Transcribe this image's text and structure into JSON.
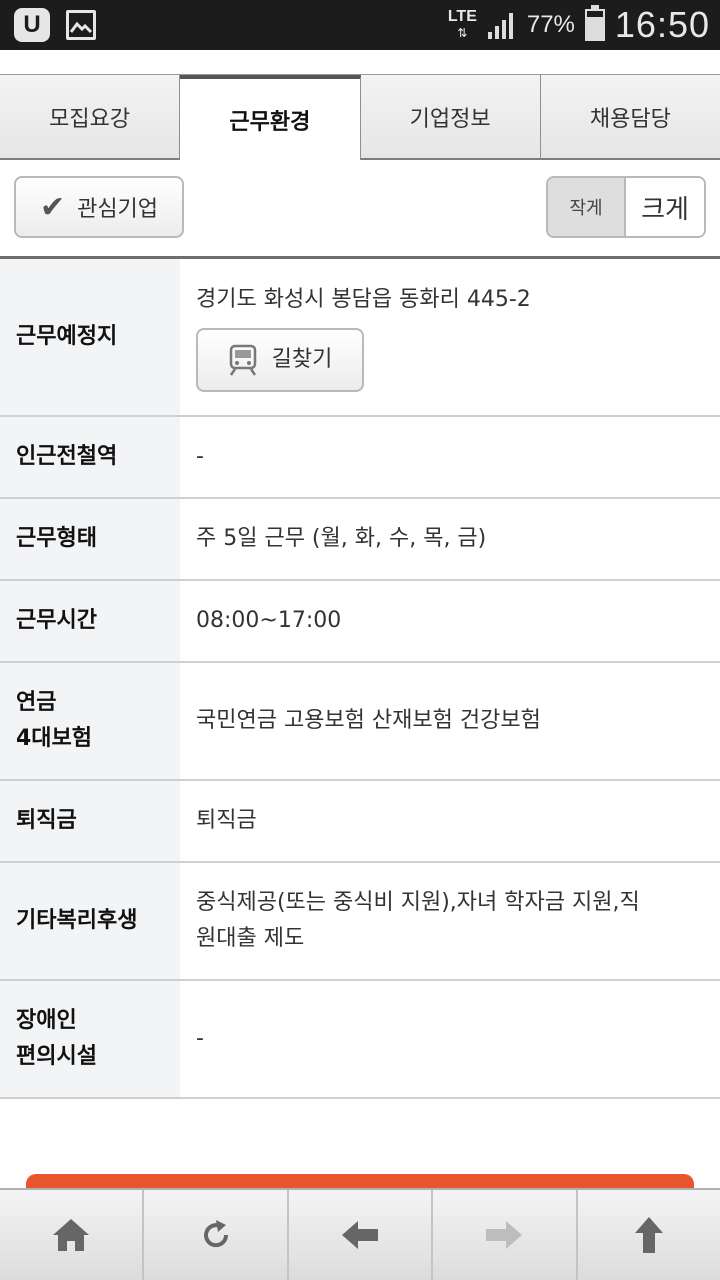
{
  "status_bar": {
    "network": "LTE",
    "battery_percent": "77%",
    "battery_level": 0.77,
    "time": "16:50",
    "icons": [
      "u-app-icon",
      "gallery-icon",
      "signal-icon",
      "battery-icon"
    ]
  },
  "tabs": [
    {
      "label": "모집요강",
      "active": false
    },
    {
      "label": "근무환경",
      "active": true
    },
    {
      "label": "기업정보",
      "active": false
    },
    {
      "label": "채용담당",
      "active": false
    }
  ],
  "toolbar": {
    "favorite_label": "관심기업",
    "size_small": "작게",
    "size_large": "크게"
  },
  "info": {
    "workplace": {
      "label": "근무예정지",
      "address": "경기도 화성시 봉담읍 동화리 445-2",
      "route_button": "길찾기"
    },
    "station": {
      "label": "인근전철역",
      "value": "-"
    },
    "work_type": {
      "label": "근무형태",
      "value": "주 5일 근무 (월, 화, 수, 목, 금)"
    },
    "work_hours": {
      "label": "근무시간",
      "value": "08:00~17:00"
    },
    "insurance": {
      "label_line1": "연금",
      "label_line2": "4대보험",
      "value": "국민연금 고용보험 산재보험 건강보험"
    },
    "severance": {
      "label": "퇴직금",
      "value": "퇴직금"
    },
    "benefits": {
      "label": "기타복리후생",
      "value_line1": "중식제공(또는 중식비 지원),자녀 학자금 지원,직",
      "value_line2": "원대출 제도"
    },
    "disability": {
      "label_line1": "장애인",
      "label_line2": "편의시설",
      "value": "-"
    }
  },
  "bottom_nav": [
    "home-icon",
    "refresh-icon",
    "back-arrow-icon",
    "forward-arrow-icon",
    "scroll-top-icon"
  ],
  "colors": {
    "accent": "#e8552f",
    "label_bg": "#f2f4f6"
  }
}
